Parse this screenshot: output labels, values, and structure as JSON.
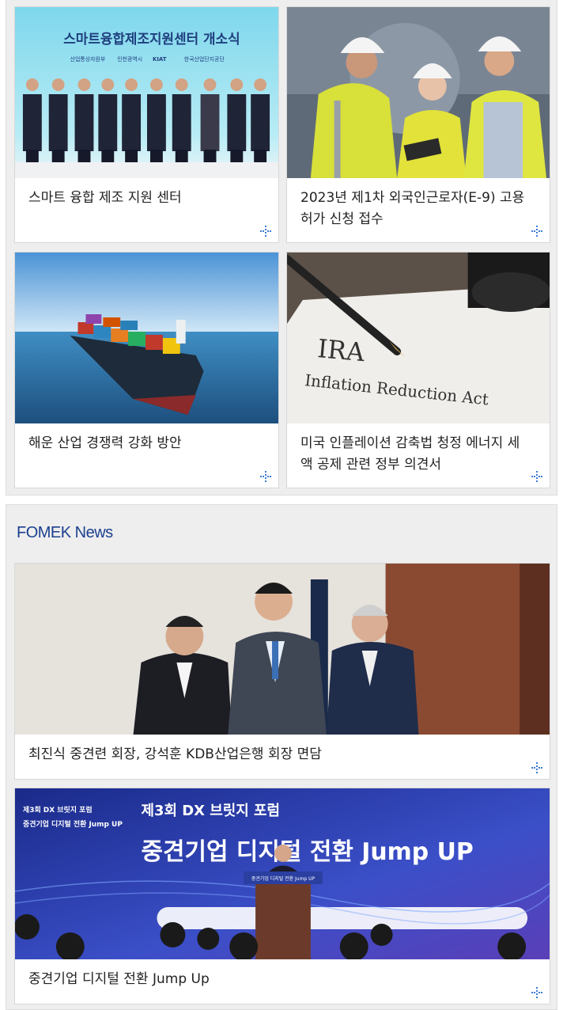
{
  "cards_top": [
    {
      "caption": "스마트 융합 제조 지원 센터",
      "image": "opening-ceremony-photo"
    },
    {
      "caption": "2023년 제1차 외국인근로자(E-9) 고용 허가 신청 접수",
      "image": "factory-workers-photo"
    },
    {
      "caption": "해운 산업 경쟁력 강화 방안",
      "image": "cargo-ship-photo"
    },
    {
      "caption": "미국 인플레이션 감축법 청정 에너지 세액 공제 관련 정부 의견서",
      "image": "ira-document-photo"
    }
  ],
  "ceremony_banner": {
    "title": "스마트융합제조지원센터 개소식",
    "logos": [
      "산업통상자원부",
      "인천광역시",
      "KIAT",
      "한국산업단지공단"
    ]
  },
  "ira_document": {
    "line1": "IRA",
    "line2": "Inflation Reduction Act"
  },
  "news": {
    "section_title": "FOMEK News",
    "items": [
      {
        "caption": "최진식 중견련 회장, 강석훈 KDB산업은행 회장 면담",
        "image": "meeting-photo"
      },
      {
        "caption": "중견기업 디지털 전환 Jump Up",
        "image": "forum-photo"
      }
    ]
  },
  "forum_banner": {
    "small_title": "제3회 DX 브릿지 포럼",
    "small_sub": "중견기업 디지털 전환 Jump UP",
    "title": "제3회 DX 브릿지 포럼",
    "headline": "중견기업 디지털 전환 Jump UP",
    "podium": "중견기업 디지털 전환 Jump UP"
  },
  "colors": {
    "accent": "#1b3f8f",
    "more_icon": "#3a7bd5"
  }
}
